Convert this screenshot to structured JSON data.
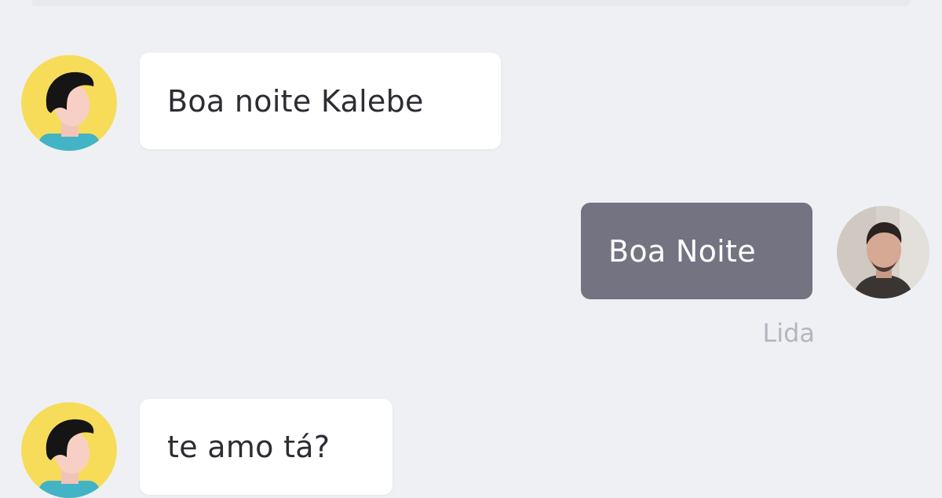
{
  "messages": [
    {
      "direction": "incoming",
      "text": "Boa noite Kalebe",
      "avatar": "default-user-avatar-icon"
    },
    {
      "direction": "outgoing",
      "text": "Boa Noite",
      "avatar": "user-photo-avatar",
      "status": "Lida"
    },
    {
      "direction": "incoming",
      "text": "te amo tá?",
      "avatar": "default-user-avatar-icon"
    }
  ],
  "colors": {
    "background": "#eef0f4",
    "incoming_bubble": "#ffffff",
    "outgoing_bubble": "#747382",
    "avatar_yellow": "#f7dc5a",
    "avatar_shirt": "#43b3c6",
    "status_text": "#b4b6bf"
  }
}
